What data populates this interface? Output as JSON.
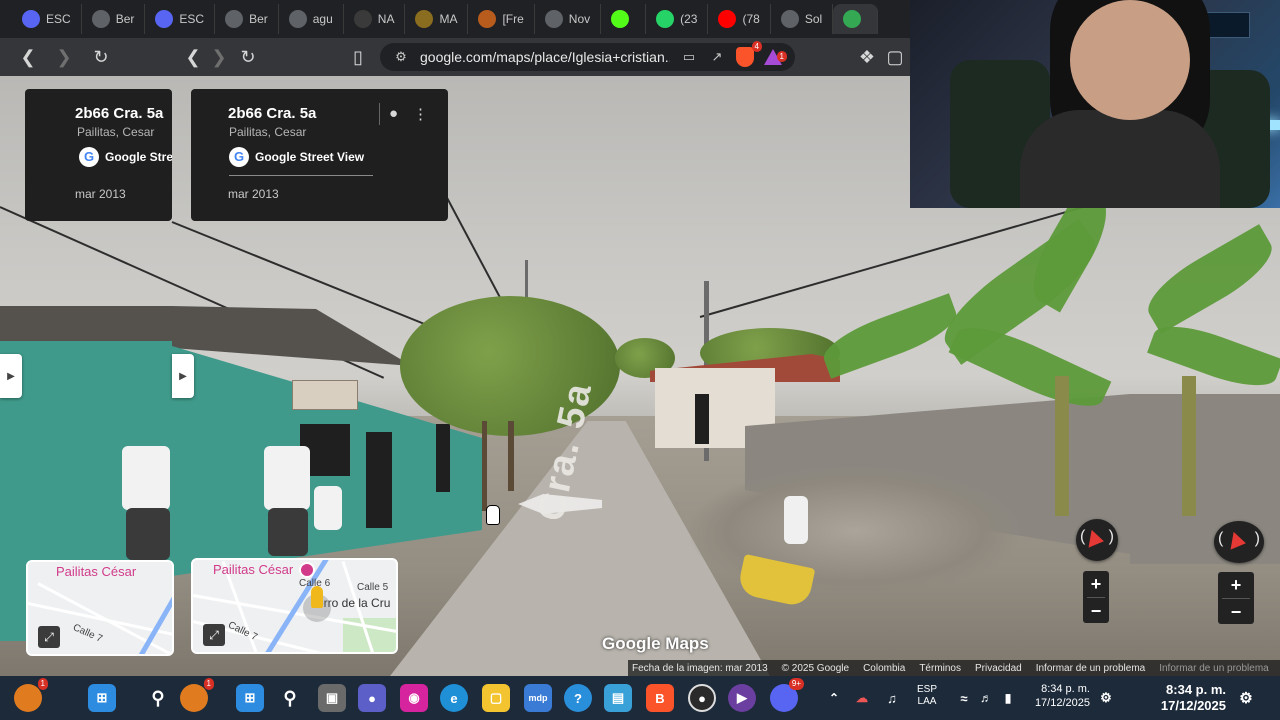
{
  "tabs": [
    {
      "label": "ESC",
      "icon": "discord-icon",
      "color": "#5865f2"
    },
    {
      "label": "Ber",
      "icon": "globe-icon",
      "color": "#5f6368"
    },
    {
      "label": "ESC",
      "icon": "discord-icon",
      "color": "#5865f2"
    },
    {
      "label": "Ber",
      "icon": "globe-icon",
      "color": "#5f6368"
    },
    {
      "label": "agu",
      "icon": "globe-icon",
      "color": "#5f6368"
    },
    {
      "label": "NA",
      "icon": "spider-icon",
      "color": "#3a3a3a"
    },
    {
      "label": "MA",
      "icon": "coin-icon",
      "color": "#8a6d1e"
    },
    {
      "label": "[Fre",
      "icon": "lion-icon",
      "color": "#b85c1e"
    },
    {
      "label": "Nov",
      "icon": "globe-icon",
      "color": "#5f6368"
    },
    {
      "label": "",
      "icon": "kick-icon",
      "color": "#53fc18"
    },
    {
      "label": "(23",
      "icon": "whatsapp-icon",
      "color": "#25d366"
    },
    {
      "label": "(78",
      "icon": "youtube-icon",
      "color": "#ff0000"
    },
    {
      "label": "Sol",
      "icon": "gear-icon",
      "color": "#5f6368"
    },
    {
      "label": "",
      "icon": "maps-icon",
      "color": "#34a853",
      "active": true
    }
  ],
  "toolbar": {
    "url": "google.com/maps/place/Iglesia+cristian...",
    "brave_badge": "4",
    "rewards_badge": "1"
  },
  "card": {
    "title": "2b66 Cra. 5a",
    "subtitle": "Pailitas, Cesar",
    "provider": "Google Street View",
    "date": "mar 2013"
  },
  "scene": {
    "street_label": "Cra. 5a"
  },
  "minimap": {
    "place_label": "Pailitas César",
    "street_1": "Calle 5",
    "street_2": "Calle 7",
    "street_3": "Calle 6",
    "poi_label": "erro de la Cru"
  },
  "attribution": {
    "logo": "Google Maps",
    "image_date": "Fecha de la imagen: mar 2013",
    "copyright": "© 2025 Google",
    "country": "Colombia",
    "terms": "Términos",
    "privacy": "Privacidad",
    "report": "Informar de un problema"
  },
  "taskbar": {
    "weather_badge": "1",
    "edge_badge": "1",
    "discord_badge": "9+",
    "lang_line1": "ESP",
    "lang_line2": "LAA",
    "time": "8:34 p. m.",
    "date": "17/12/2025"
  },
  "colors": {
    "browser_bg": "#202124",
    "toolbar_bg": "#35363a",
    "card_bg": "#1f1f1f",
    "wall_teal": "#3f9a8b",
    "taskbar_bg": "#1c2a3a",
    "accent_pink": "#d23b8a"
  }
}
